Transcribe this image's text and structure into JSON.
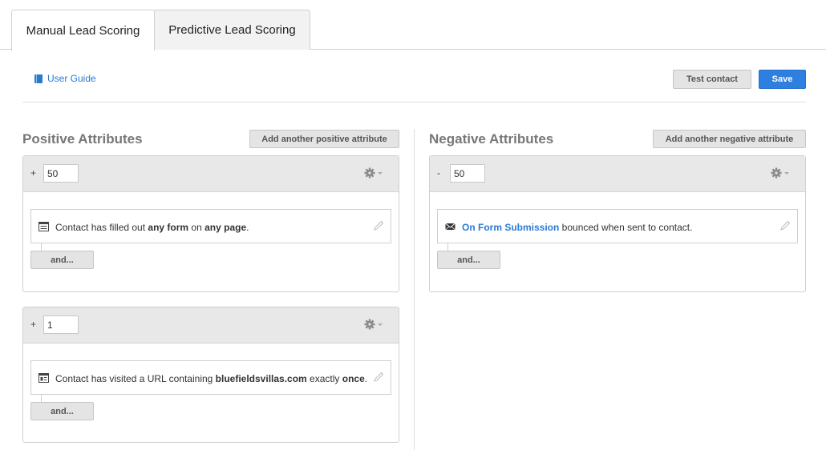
{
  "tabs": [
    {
      "label": "Manual Lead Scoring",
      "active": true
    },
    {
      "label": "Predictive Lead Scoring",
      "active": false
    }
  ],
  "toolbar": {
    "user_guide": "User Guide",
    "test_contact": "Test contact",
    "save": "Save"
  },
  "positive": {
    "title": "Positive Attributes",
    "add_button": "Add another positive attribute",
    "rules": [
      {
        "sign": "+",
        "points": "50",
        "icon": "form-icon",
        "parts": [
          "Contact has filled out ",
          "any form",
          " on ",
          "any page",
          "."
        ],
        "and_label": "and..."
      },
      {
        "sign": "+",
        "points": "1",
        "icon": "webpage-icon",
        "parts": [
          "Contact has visited a URL containing ",
          "bluefieldsvillas.com",
          " exactly ",
          "once",
          "."
        ],
        "and_label": "and..."
      }
    ]
  },
  "negative": {
    "title": "Negative Attributes",
    "add_button": "Add another negative attribute",
    "rules": [
      {
        "sign": "-",
        "points": "50",
        "icon": "envelope-icon",
        "parts": [
          "On Form Submission",
          " bounced when sent to contact."
        ],
        "and_label": "and..."
      }
    ]
  },
  "colors": {
    "accent": "#2f7fe0",
    "link": "#2a7ad4",
    "header_gray": "#e8e8e8"
  }
}
